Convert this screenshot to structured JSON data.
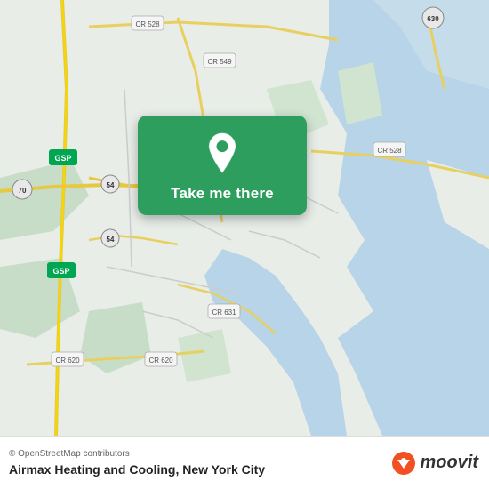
{
  "map": {
    "background_color": "#e8ede8",
    "attribution": "© OpenStreetMap contributors"
  },
  "card": {
    "button_label": "Take me there",
    "background_color": "#2e9e5e"
  },
  "bottom_bar": {
    "osm_credit": "© OpenStreetMap contributors",
    "place_name": "Airmax Heating and Cooling, New York City",
    "moovit_text": "moovit"
  }
}
